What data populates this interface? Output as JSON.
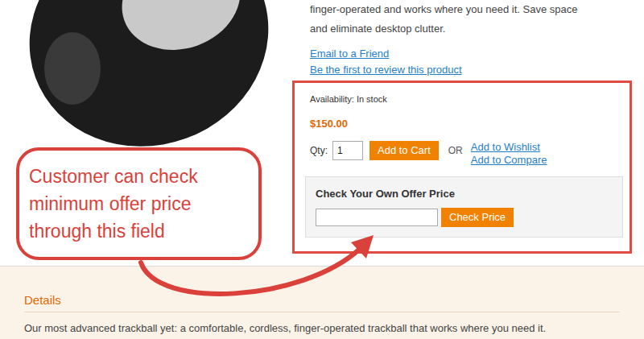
{
  "product": {
    "description_lines": [
      "finger-operated and works where you need it. Save space",
      "and eliminate desktop clutter."
    ],
    "links": [
      "Email to a Friend",
      "Be the first to review this product"
    ]
  },
  "purchase": {
    "availability": "Availability: In stock",
    "price": "$150.00",
    "qty_label": "Qty:",
    "qty": "1",
    "add_to_cart": "Add to Cart",
    "or": "OR",
    "links": [
      "Add to Wishlist",
      "Add to Compare"
    ]
  },
  "offer": {
    "title": "Check Your Own Offer Price",
    "value": "",
    "button": "Check Price"
  },
  "callout": {
    "lines": [
      "Customer can check",
      "minimum offer price",
      "through this field"
    ]
  },
  "details": {
    "title": "Details",
    "text": "Our most advanced trackball yet: a comfortable, cordless, finger-operated trackball that works where you need it."
  }
}
